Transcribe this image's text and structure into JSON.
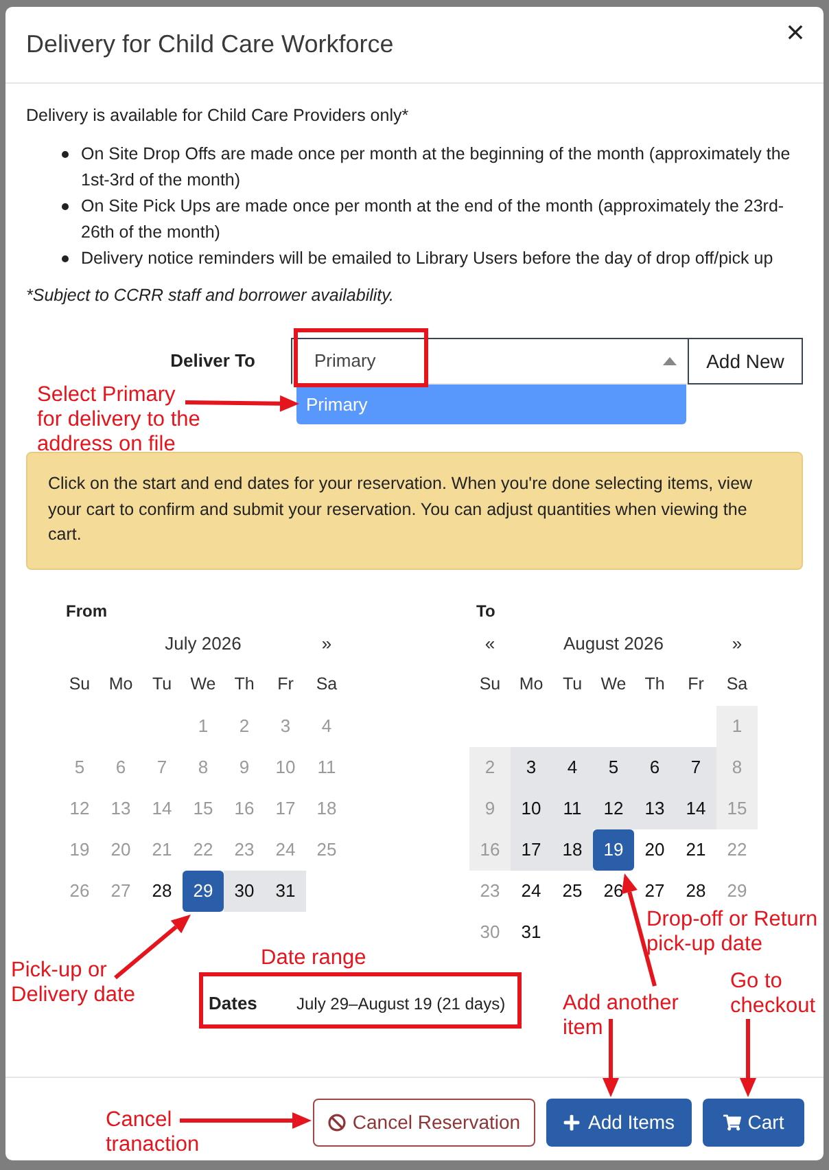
{
  "dialog": {
    "title": "Delivery for Child Care Workforce"
  },
  "intro": "Delivery is available for Child Care Providers only*",
  "bullets": [
    "On Site Drop Offs are made once per month at the beginning of the month (approximately the 1st-3rd of the month)",
    "On Site Pick Ups are made once per month at the end of the month (approximately the 23rd-26th of the month)",
    "Delivery notice reminders will be emailed to Library Users before the day of drop off/pick up"
  ],
  "footnote": "*Subject to CCRR staff and borrower availability.",
  "deliver_to": {
    "label": "Deliver To",
    "value": "Primary",
    "expanded": true,
    "options": [
      {
        "label": "Primary",
        "selected": true
      }
    ],
    "add_button": "Add New"
  },
  "notice": "Click on the start and end dates for your reservation. When you're done selecting items, view your cart to confirm and submit your reservation. You can adjust quantities when viewing the cart.",
  "calendars": [
    {
      "label": "From",
      "month": "July 2026",
      "next": "»",
      "weekdays": [
        "Su",
        "Mo",
        "Tu",
        "We",
        "Th",
        "Fr",
        "Sa"
      ],
      "weeks": [
        [
          {
            "day": "1",
            "disabled": true,
            "in_range": false,
            "selected": false
          },
          {
            "day": "2",
            "disabled": true,
            "in_range": false,
            "selected": false
          },
          {
            "day": "3",
            "disabled": true,
            "in_range": false,
            "selected": false
          },
          {
            "day": "4",
            "disabled": true,
            "in_range": false,
            "selected": false
          }
        ],
        [
          {
            "day": "5",
            "disabled": true,
            "in_range": false,
            "selected": false
          },
          {
            "day": "6",
            "disabled": true,
            "in_range": false,
            "selected": false
          },
          {
            "day": "7",
            "disabled": true,
            "in_range": false,
            "selected": false
          },
          {
            "day": "8",
            "disabled": true,
            "in_range": false,
            "selected": false
          },
          {
            "day": "9",
            "disabled": true,
            "in_range": false,
            "selected": false
          },
          {
            "day": "10",
            "disabled": true,
            "in_range": false,
            "selected": false
          },
          {
            "day": "11",
            "disabled": true,
            "in_range": false,
            "selected": false
          }
        ],
        [
          {
            "day": "12",
            "disabled": true,
            "in_range": false,
            "selected": false
          },
          {
            "day": "13",
            "disabled": true,
            "in_range": false,
            "selected": false
          },
          {
            "day": "14",
            "disabled": true,
            "in_range": false,
            "selected": false
          },
          {
            "day": "15",
            "disabled": true,
            "in_range": false,
            "selected": false
          },
          {
            "day": "16",
            "disabled": true,
            "in_range": false,
            "selected": false
          },
          {
            "day": "17",
            "disabled": true,
            "in_range": false,
            "selected": false
          },
          {
            "day": "18",
            "disabled": true,
            "in_range": false,
            "selected": false
          }
        ],
        [
          {
            "day": "19",
            "disabled": true,
            "in_range": false,
            "selected": false
          },
          {
            "day": "20",
            "disabled": true,
            "in_range": false,
            "selected": false
          },
          {
            "day": "21",
            "disabled": true,
            "in_range": false,
            "selected": false
          },
          {
            "day": "22",
            "disabled": true,
            "in_range": false,
            "selected": false
          },
          {
            "day": "23",
            "disabled": true,
            "in_range": false,
            "selected": false
          },
          {
            "day": "24",
            "disabled": true,
            "in_range": false,
            "selected": false
          },
          {
            "day": "25",
            "disabled": true,
            "in_range": false,
            "selected": false
          }
        ],
        [
          {
            "day": "26",
            "disabled": true,
            "in_range": false,
            "selected": false
          },
          {
            "day": "27",
            "disabled": true,
            "in_range": false,
            "selected": false
          },
          {
            "day": "28",
            "disabled": false,
            "in_range": false,
            "selected": false
          },
          {
            "day": "29",
            "disabled": false,
            "in_range": false,
            "selected": true
          },
          {
            "day": "30",
            "disabled": false,
            "in_range": true,
            "selected": false
          },
          {
            "day": "31",
            "disabled": false,
            "in_range": true,
            "selected": false
          }
        ]
      ]
    },
    {
      "label": "To",
      "prev": "«",
      "month": "August 2026",
      "next": "»",
      "weekdays": [
        "Su",
        "Mo",
        "Tu",
        "We",
        "Th",
        "Fr",
        "Sa"
      ],
      "weeks": [
        [
          {
            "day": "1",
            "disabled": true,
            "in_range": true,
            "selected": false
          }
        ],
        [
          {
            "day": "2",
            "disabled": true,
            "in_range": true,
            "selected": false
          },
          {
            "day": "3",
            "disabled": false,
            "in_range": true,
            "selected": false
          },
          {
            "day": "4",
            "disabled": false,
            "in_range": true,
            "selected": false
          },
          {
            "day": "5",
            "disabled": false,
            "in_range": true,
            "selected": false
          },
          {
            "day": "6",
            "disabled": false,
            "in_range": true,
            "selected": false
          },
          {
            "day": "7",
            "disabled": false,
            "in_range": true,
            "selected": false
          },
          {
            "day": "8",
            "disabled": true,
            "in_range": true,
            "selected": false
          }
        ],
        [
          {
            "day": "9",
            "disabled": true,
            "in_range": true,
            "selected": false
          },
          {
            "day": "10",
            "disabled": false,
            "in_range": true,
            "selected": false
          },
          {
            "day": "11",
            "disabled": false,
            "in_range": true,
            "selected": false
          },
          {
            "day": "12",
            "disabled": false,
            "in_range": true,
            "selected": false
          },
          {
            "day": "13",
            "disabled": false,
            "in_range": true,
            "selected": false
          },
          {
            "day": "14",
            "disabled": false,
            "in_range": true,
            "selected": false
          },
          {
            "day": "15",
            "disabled": true,
            "in_range": true,
            "selected": false
          }
        ],
        [
          {
            "day": "16",
            "disabled": true,
            "in_range": true,
            "selected": false
          },
          {
            "day": "17",
            "disabled": false,
            "in_range": true,
            "selected": false
          },
          {
            "day": "18",
            "disabled": false,
            "in_range": true,
            "selected": false
          },
          {
            "day": "19",
            "disabled": false,
            "in_range": false,
            "selected": true
          },
          {
            "day": "20",
            "disabled": false,
            "in_range": false,
            "selected": false
          },
          {
            "day": "21",
            "disabled": false,
            "in_range": false,
            "selected": false
          },
          {
            "day": "22",
            "disabled": true,
            "in_range": false,
            "selected": false
          }
        ],
        [
          {
            "day": "23",
            "disabled": true,
            "in_range": false,
            "selected": false
          },
          {
            "day": "24",
            "disabled": false,
            "in_range": false,
            "selected": false
          },
          {
            "day": "25",
            "disabled": false,
            "in_range": false,
            "selected": false
          },
          {
            "day": "26",
            "disabled": false,
            "in_range": false,
            "selected": false
          },
          {
            "day": "27",
            "disabled": false,
            "in_range": false,
            "selected": false
          },
          {
            "day": "28",
            "disabled": false,
            "in_range": false,
            "selected": false
          },
          {
            "day": "29",
            "disabled": true,
            "in_range": false,
            "selected": false
          }
        ],
        [
          {
            "day": "30",
            "disabled": true,
            "in_range": false,
            "selected": false
          },
          {
            "day": "31",
            "disabled": false,
            "in_range": false,
            "selected": false
          }
        ]
      ]
    }
  ],
  "dates": {
    "label": "Dates",
    "value": "July 29–August 19 (21 days)"
  },
  "buttons": [
    {
      "kind": "cancel",
      "label": "Cancel Reservation"
    },
    {
      "kind": "add",
      "label": "Add Items"
    },
    {
      "kind": "cart",
      "label": "Cart"
    }
  ],
  "annotations": [
    {
      "text": "Select Primary\nfor delivery to the\naddress on file"
    },
    {
      "text": "Pick-up or\nDelivery date"
    },
    {
      "text": "Date range"
    },
    {
      "text": "Drop-off or Return\npick-up date"
    },
    {
      "text": "Add another\nitem"
    },
    {
      "text": "Go to\ncheckout"
    },
    {
      "text": "Cancel\ntranaction"
    }
  ]
}
